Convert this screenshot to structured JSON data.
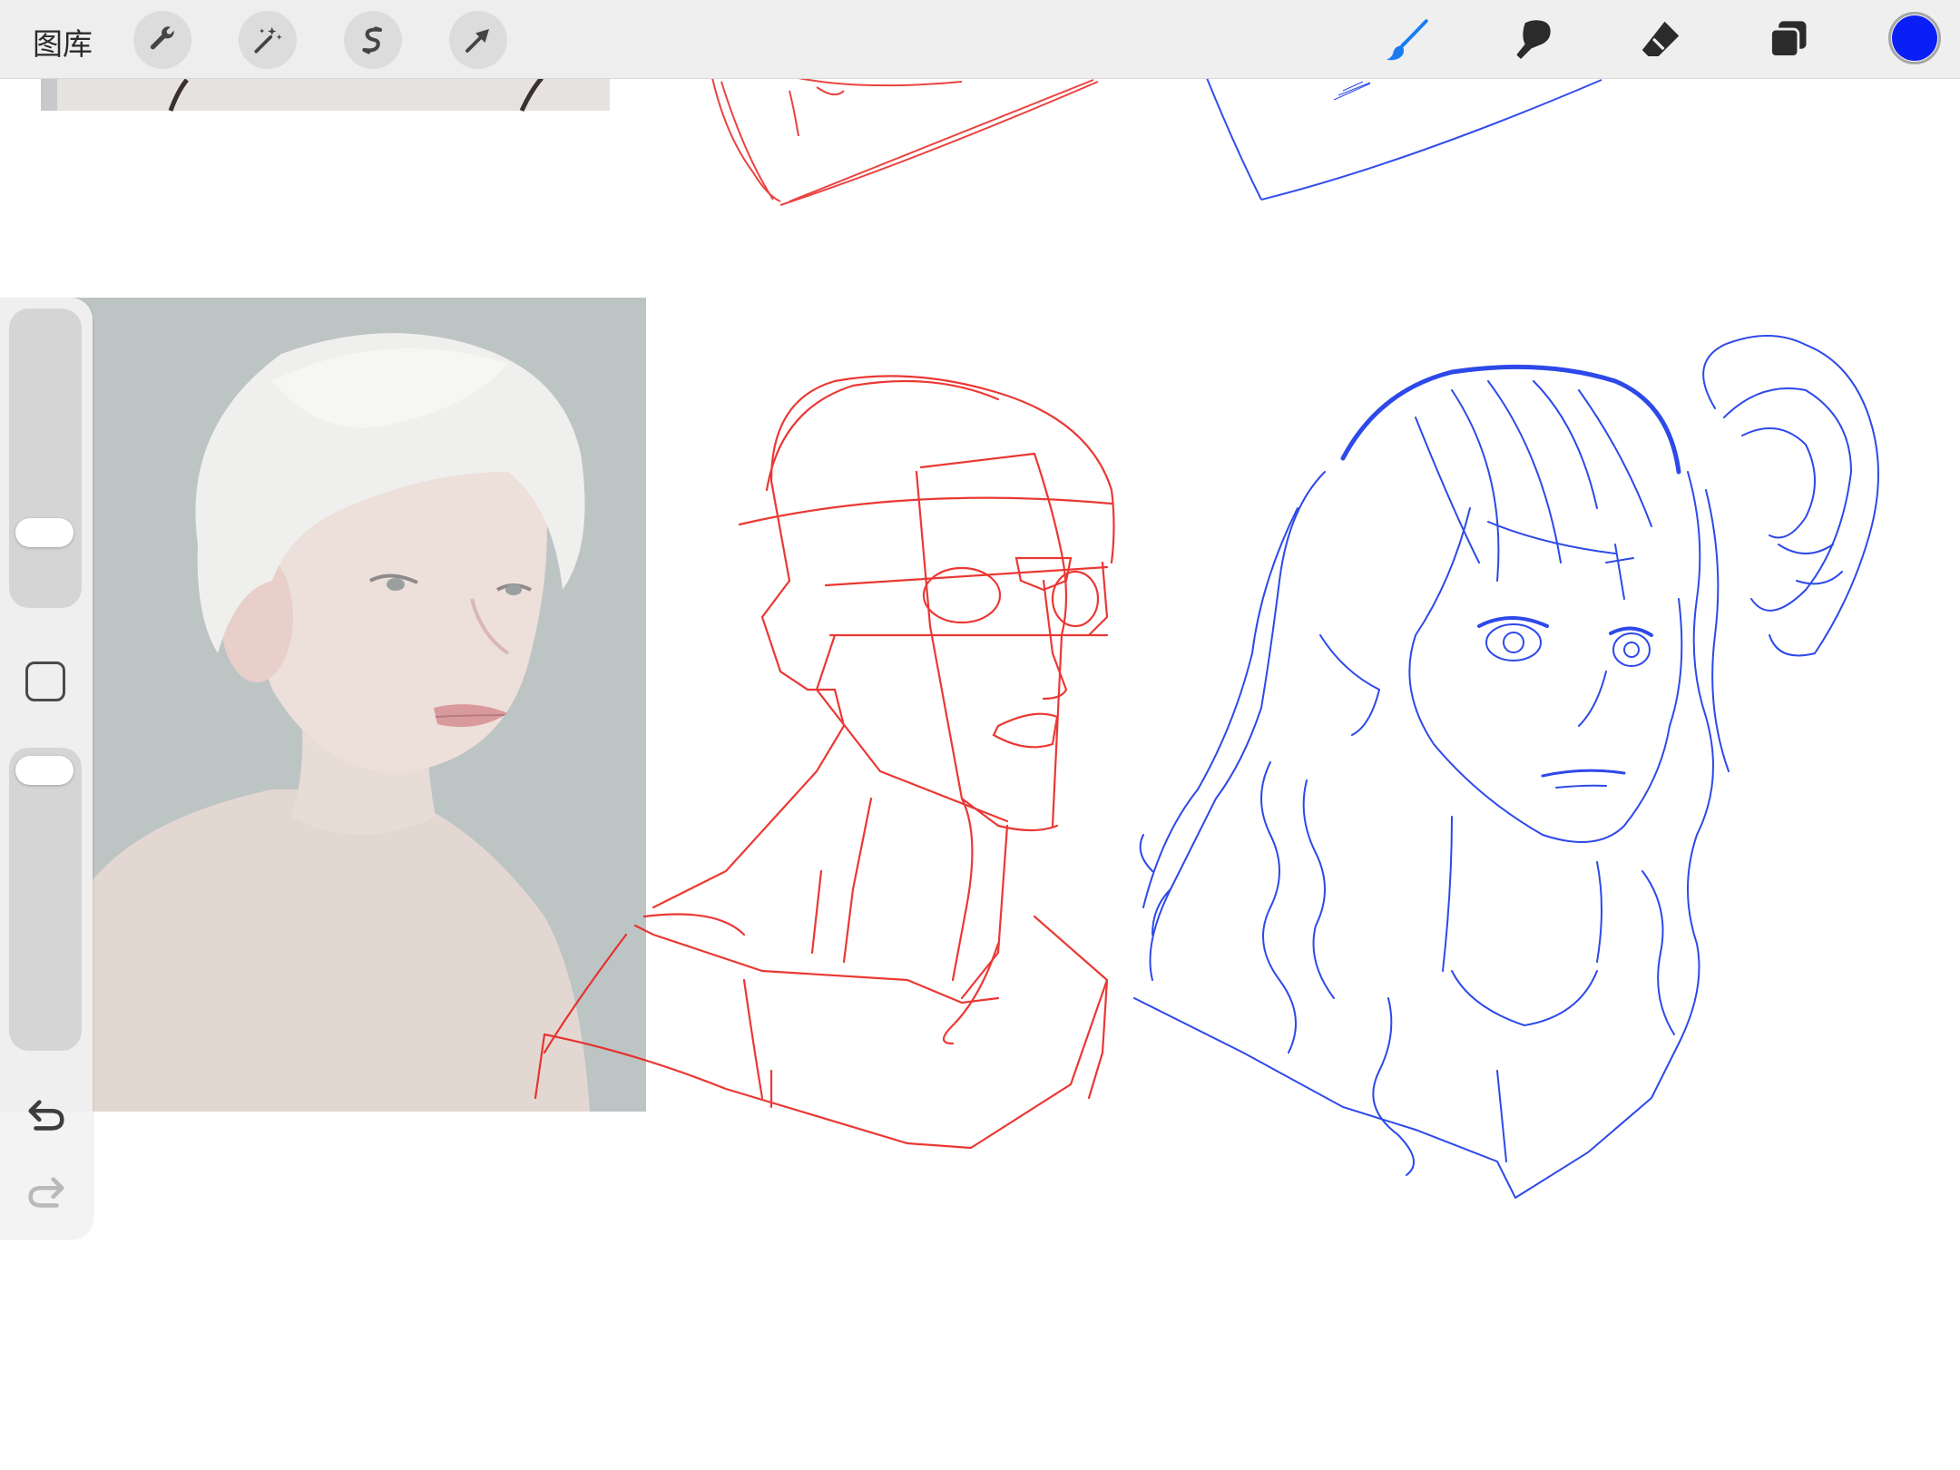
{
  "toolbar": {
    "gallery_label": "图库",
    "left_buttons": [
      {
        "icon": "wrench-icon",
        "name": "actions-button"
      },
      {
        "icon": "magic-wand-icon",
        "name": "adjustments-button"
      },
      {
        "icon": "selection-s-icon",
        "name": "selection-button"
      },
      {
        "icon": "arrow-cursor-icon",
        "name": "transform-button"
      }
    ],
    "right_tools": [
      {
        "icon": "brush-icon",
        "name": "brush-tool",
        "active": true
      },
      {
        "icon": "smudge-icon",
        "name": "smudge-tool",
        "active": false
      },
      {
        "icon": "eraser-icon",
        "name": "eraser-tool",
        "active": false
      },
      {
        "icon": "layers-icon",
        "name": "layers-button",
        "active": false
      }
    ],
    "current_color": "#0a1ff5",
    "active_tool_color": "#1a7cf3"
  },
  "sidebar": {
    "brush_size_icon": "slider-thumb",
    "modify_icon": "square-icon",
    "opacity_icon": "slider-thumb",
    "undo_icon": "undo-icon",
    "redo_icon": "redo-icon"
  },
  "canvas": {
    "sketch_colors": {
      "red": "#e8231f",
      "blue": "#1c3ae8"
    },
    "reference_photo": "photo-reference"
  }
}
